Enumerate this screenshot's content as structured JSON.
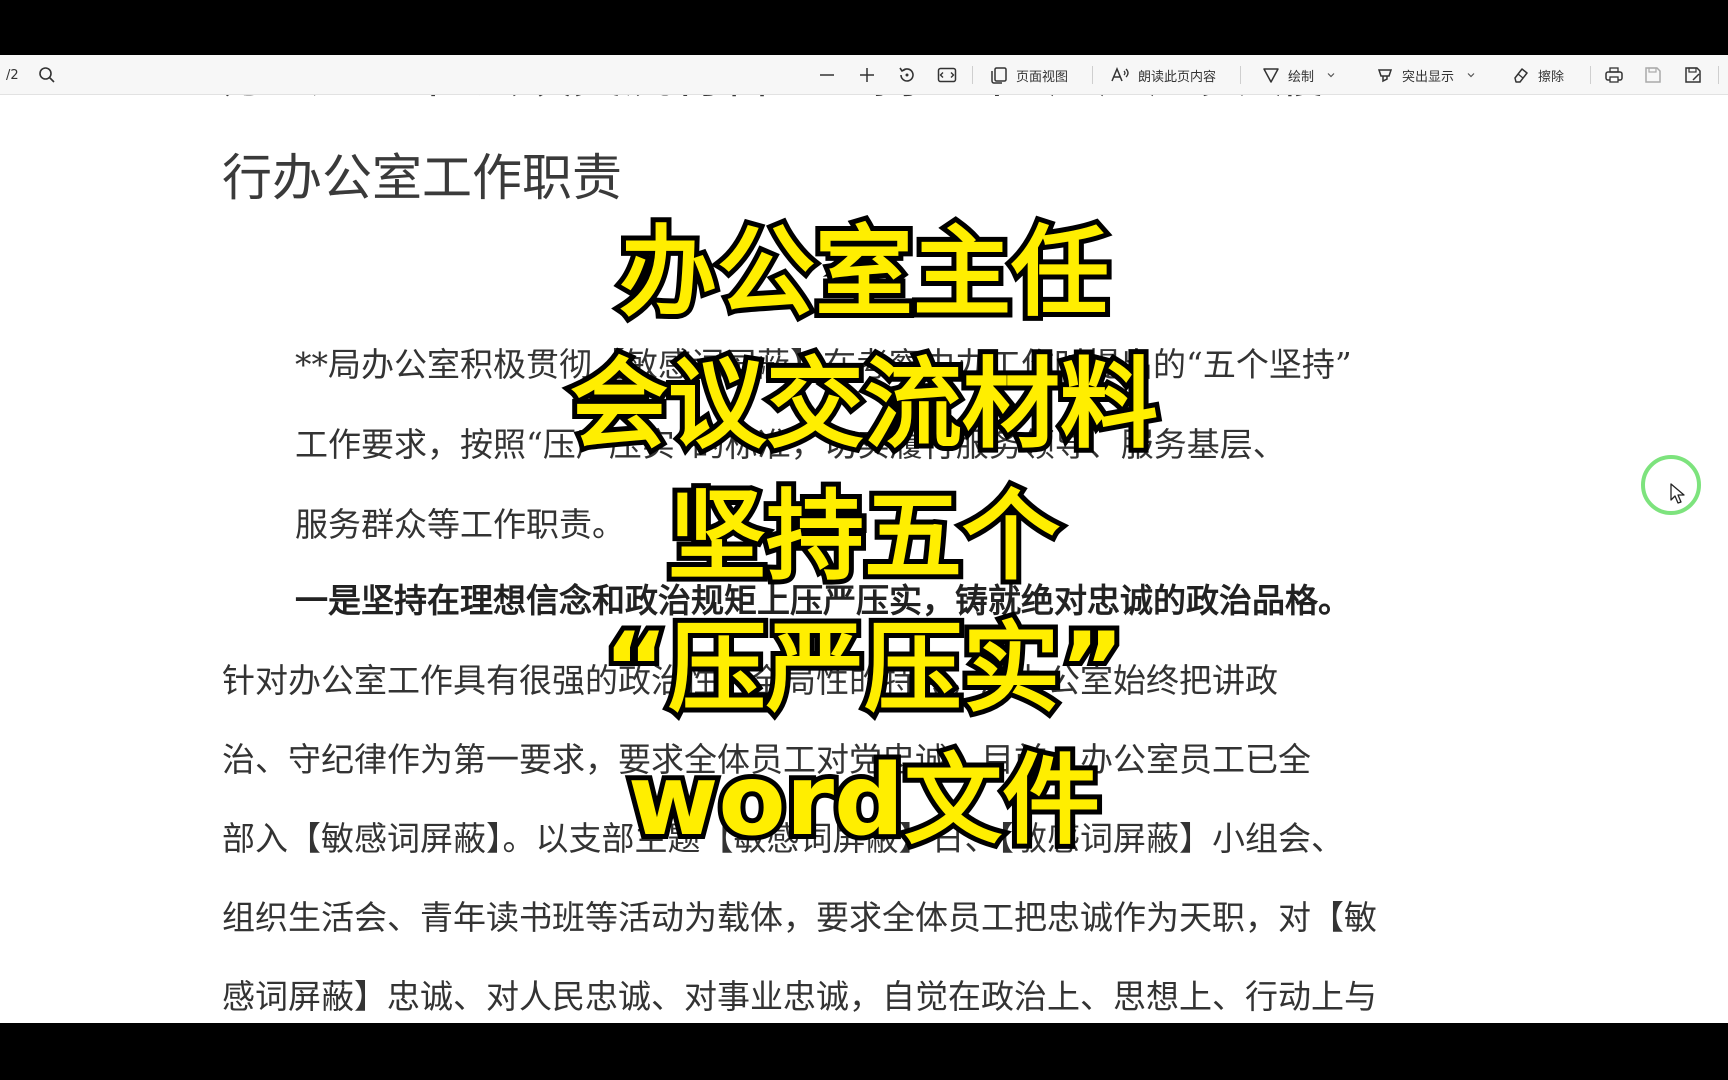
{
  "toolbar": {
    "page_indicator": "/2",
    "page_view_label": "页面视图",
    "read_aloud_label": "朗读此页内容",
    "draw_label": "绘制",
    "highlight_label": "突出显示",
    "erase_label": "擦除"
  },
  "document": {
    "title_line1": "办公室主任会议交流材料：坚持五个“压严压实”履",
    "title_line2": "行办公室工作职责",
    "lines": [
      "**局办公室积极贯彻【敏感词屏蔽】在考察中办工作时提出的“五个坚持”",
      "工作要求，按照“压严压实”的标准，切实履行服务领导、服务基层、",
      "服务群众等工作职责。",
      "一是坚持在理想信念和政治规矩上压严压实，铸就绝对忠诚的政治品格。",
      "针对办公室工作具有很强的政治性、全局性的特点，局办公室始终把讲政",
      "治、守纪律作为第一要求，要求全体员工对党忠诚。目前，办公室员工已全",
      "部入【敏感词屏蔽】。以支部主题【敏感词屏蔽】日、【敏感词屏蔽】小组会、",
      "组织生活会、青年读书班等活动为载体，要求全体员工把忠诚作为天职，对【敏",
      "感词屏蔽】忠诚、对人民忠诚、对事业忠诚，自觉在政治上、思想上、行动上与"
    ]
  },
  "overlay": {
    "line1": "办公室主任",
    "line2": "会议交流材料",
    "line3": "坚持五个",
    "line4": "“压严压实”",
    "line5": "word文件"
  }
}
